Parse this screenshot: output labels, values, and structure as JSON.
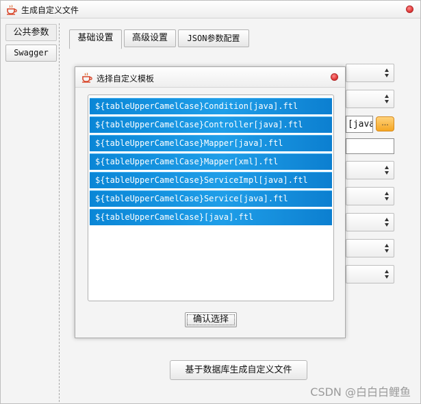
{
  "window": {
    "title": "生成自定义文件"
  },
  "sidebar": {
    "items": [
      {
        "label": "公共参数"
      },
      {
        "label": "Swagger"
      }
    ]
  },
  "tabs": [
    {
      "label": "基础设置",
      "active": true
    },
    {
      "label": "高级设置",
      "active": false
    },
    {
      "label": "JSON参数配置",
      "active": false
    }
  ],
  "form": {
    "path_value": "[java]",
    "browse_label": "..."
  },
  "dialog": {
    "title": "选择自定义模板",
    "templates": [
      "${tableUpperCamelCase}Condition[java].ftl",
      "${tableUpperCamelCase}Controller[java].ftl",
      "${tableUpperCamelCase}Mapper[java].ftl",
      "${tableUpperCamelCase}Mapper[xml].ftl",
      "${tableUpperCamelCase}ServiceImpl[java].ftl",
      "${tableUpperCamelCase}Service[java].ftl",
      "${tableUpperCamelCase}[java].ftl"
    ],
    "confirm_label": "确认选择"
  },
  "actions": {
    "generate_label": "基于数据库生成自定义文件"
  },
  "watermark": "CSDN @白白白鲤鱼",
  "colors": {
    "selection_blue": "#1f9ee8",
    "close_red": "#e23b3b",
    "browse_orange": "#f5a623"
  }
}
